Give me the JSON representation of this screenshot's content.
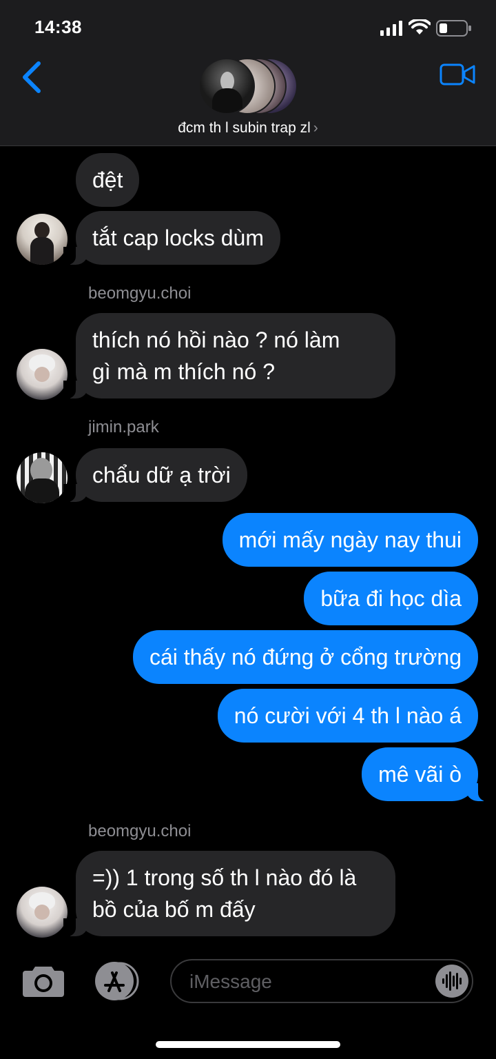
{
  "status_bar": {
    "time": "14:38"
  },
  "header": {
    "group_name": "đcm th l subin trap zl",
    "chevron": "›"
  },
  "messages": [
    {
      "text": "đệt"
    },
    {
      "text": "tắt cap locks dùm"
    },
    {
      "sender": "beomgyu.choi",
      "text_line1": "thích nó hồi nào ? nó làm",
      "text_line2": "gì mà m thích nó ?"
    },
    {
      "sender": "jimin.park",
      "text": "chẩu dữ ạ trời"
    },
    {
      "text": "mới mấy ngày nay thui"
    },
    {
      "text": "bữa đi học dìa"
    },
    {
      "text": "cái thấy nó đứng ở cổng trường"
    },
    {
      "text": "nó cười với 4 th l nào á"
    },
    {
      "text": "mê vãi ò"
    },
    {
      "sender": "beomgyu.choi",
      "text_line1": "=)) 1 trong số th l nào đó là",
      "text_line2": "bồ của bố m đấy"
    }
  ],
  "composer": {
    "placeholder": "iMessage"
  },
  "colors": {
    "accent": "#0b84fe",
    "incoming_bubble": "#262628",
    "header_bg": "#1c1c1e"
  },
  "icons": [
    "back-chevron-icon",
    "video-camera-icon",
    "camera-icon",
    "app-store-icon",
    "audio-waveform-icon",
    "signal-icon",
    "wifi-icon",
    "battery-icon"
  ]
}
